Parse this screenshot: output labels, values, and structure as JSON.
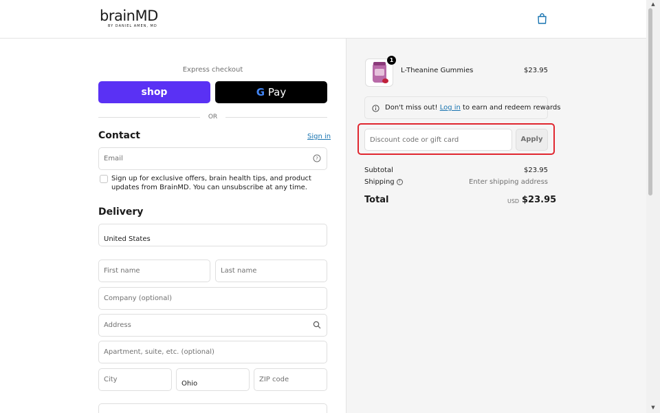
{
  "header": {
    "logo_text": "brainMD",
    "logo_subtext": "BY DANIEL AMEN, MD",
    "bag_icon": "shopping-bag-icon"
  },
  "express": {
    "label": "Express checkout",
    "shop_label": "shop",
    "gpay_g": "G",
    "gpay_label": "Pay",
    "or_label": "OR"
  },
  "contact": {
    "title": "Contact",
    "signin_label": "Sign in",
    "email_placeholder": "Email",
    "newsletter_label": "Sign up for exclusive offers, brain health tips, and product updates from BrainMD. You can unsubscribe at any time."
  },
  "delivery": {
    "title": "Delivery",
    "country_value": "United States",
    "first_name_placeholder": "First name",
    "last_name_placeholder": "Last name",
    "company_placeholder": "Company (optional)",
    "address_placeholder": "Address",
    "apartment_placeholder": "Apartment, suite, etc. (optional)",
    "city_placeholder": "City",
    "state_value": "Ohio",
    "zip_placeholder": "ZIP code"
  },
  "summary": {
    "item": {
      "quantity": "1",
      "name": "L-Theanine Gummies",
      "price": "$23.95"
    },
    "rewards": {
      "prefix": "Don't miss out!",
      "login_label": "Log in",
      "suffix": "to earn and redeem rewards"
    },
    "discount_placeholder": "Discount code or gift card",
    "apply_label": "Apply",
    "subtotal_label": "Subtotal",
    "subtotal_value": "$23.95",
    "shipping_label": "Shipping",
    "shipping_value": "Enter shipping address",
    "total_label": "Total",
    "total_currency": "USD",
    "total_value": "$23.95"
  },
  "colors": {
    "shop_purple": "#5a31f4",
    "link_blue": "#1773b0",
    "highlight_red": "#e0252e"
  }
}
